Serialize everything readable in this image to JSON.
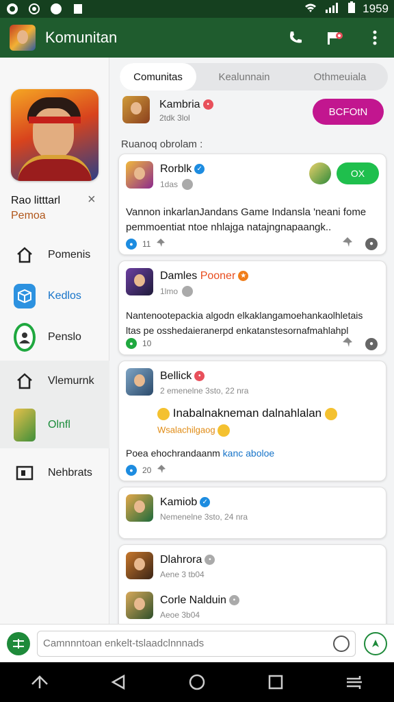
{
  "status": {
    "time": "1959"
  },
  "app": {
    "title": "Komunitan"
  },
  "sidebar": {
    "profile_name": "Rao litttarl",
    "profile_sub": "Pemoa",
    "close_glyph": "×",
    "items": [
      {
        "label": "Pomenis",
        "icon": "home-icon"
      },
      {
        "label": "Kedlos",
        "icon": "cube-icon"
      },
      {
        "label": "Penslo",
        "icon": "profile-icon"
      },
      {
        "label": "Vlemurnk",
        "icon": "home-icon"
      },
      {
        "label": "Olnfl",
        "icon": "avatar-icon"
      },
      {
        "label": "Nehbrats",
        "icon": "window-icon"
      }
    ]
  },
  "tabs": [
    "Comunitas",
    "Kealunnain",
    "Othmeuiala"
  ],
  "sticky": {
    "name": "Kambria",
    "sub": "2tdk 3lol",
    "button": "BCFOtN"
  },
  "section_label": "Ruanoq obrolam :",
  "posts": [
    {
      "name": "Rorblk",
      "meta": "1das",
      "body": "Vannon inkarlanJandans Game Indansla 'neani fome pemmoentiat ntoe nhlajga natajngnapaangk..",
      "count": "11",
      "join": "OX"
    },
    {
      "name": "Damles",
      "tag": "Pooner",
      "meta": "1lmo",
      "body": "Nantenootepackia algodn elkaklangamoehankaolhletais ltas pe osshedaieranerpd enkatanstesornafmahlahpl",
      "count": "10"
    },
    {
      "name": "Bellick",
      "meta": "2 emenelne 3sto, 22 nra",
      "title": "Inabalnakneman dalnahlalan",
      "subtitle": "Wsalachilgaog",
      "extra_text": "Poea ehochrandaanm",
      "extra_link": "kanc aboloe",
      "count": "20"
    },
    {
      "name": "Kamiob",
      "meta": "Nemenelne 3sto, 24 nra"
    },
    {
      "name": "Dlahrora",
      "meta": "Aene 3 tb04"
    },
    {
      "name": "Corle Nalduin",
      "meta": "Aeoe 3b04"
    }
  ],
  "composer": {
    "placeholder": "Camnnntoan enkelt-tslaadclnnnads"
  }
}
